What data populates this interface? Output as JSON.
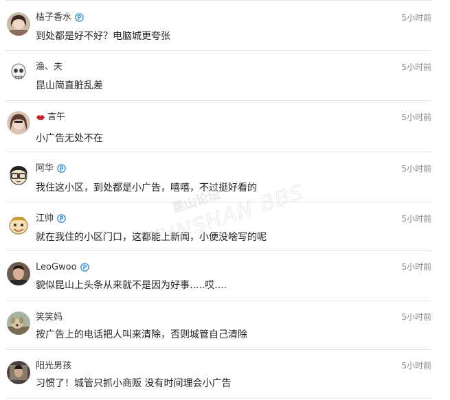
{
  "comments": [
    {
      "user": "桔子香水",
      "time": "5小时前",
      "text": "到处都是好不好？电脑城更夸张",
      "avatar": "woman-photo-avatar",
      "verified": true
    },
    {
      "user": "渔、夫",
      "time": "5小时前",
      "text": "昆山简直脏乱差",
      "avatar": "skull-sketch-avatar",
      "verified": false
    },
    {
      "user": "言午",
      "time": "5小时前",
      "text": "小广告无处不在",
      "avatar": "girl-photo-avatar",
      "verified": false,
      "prefix_icon": "lips-icon"
    },
    {
      "user": "阿华",
      "time": "5小时前",
      "text": "我住这小区，到处都是小广告，嘻嘻，不过挺好看的",
      "avatar": "cartoon-glasses-avatar",
      "verified": true
    },
    {
      "user": "江帅",
      "time": "5小时前",
      "text": "就在我住的小区门口，这都能上新闻，小便没啥写的呢",
      "avatar": "cartoon-face-avatar",
      "verified": true
    },
    {
      "user": "LeoGwoo",
      "time": "5小时前",
      "text": "貌似昆山上头条从来就不是因为好事.....哎....",
      "avatar": "man-photo-avatar",
      "verified": true
    },
    {
      "user": "笑笑妈",
      "time": "5小时前",
      "text": "按广告上的电话把人叫来清除，否则城管自己清除",
      "avatar": "dog-photo-avatar",
      "verified": false
    },
    {
      "user": "阳光男孩",
      "time": "5小时前",
      "text": "习惯了！城管只抓小商贩 没有时间理会小广告",
      "avatar": "dark-photo-avatar",
      "verified": false
    }
  ],
  "watermark": {
    "line1": "昆山论坛",
    "line2": "KUNSHAN BBS"
  },
  "colors": {
    "verify": "#3a8fd6",
    "divider": "#e6e6e6",
    "time": "#888888"
  }
}
